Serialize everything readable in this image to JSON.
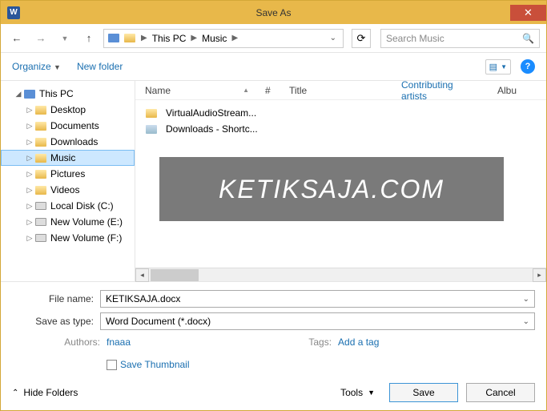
{
  "title": "Save As",
  "word_icon_letter": "W",
  "breadcrumb": {
    "item1": "This PC",
    "item2": "Music"
  },
  "search_placeholder": "Search Music",
  "toolbar": {
    "organize": "Organize",
    "newfolder": "New folder"
  },
  "tree": {
    "this_pc": "This PC",
    "desktop": "Desktop",
    "documents": "Documents",
    "downloads": "Downloads",
    "music": "Music",
    "pictures": "Pictures",
    "videos": "Videos",
    "local_c": "Local Disk (C:)",
    "vol_e": "New Volume (E:)",
    "vol_f": "New Volume (F:)"
  },
  "columns": {
    "name": "Name",
    "num": "#",
    "title": "Title",
    "contrib": "Contributing artists",
    "album": "Albu"
  },
  "files": {
    "f1": "VirtualAudioStream...",
    "f2": "Downloads - Shortc..."
  },
  "watermark": "KETIKSAJA.COM",
  "filename_label": "File name:",
  "filename_value": "KETIKSAJA.docx",
  "saveas_label": "Save as type:",
  "saveas_value": "Word Document (*.docx)",
  "authors_label": "Authors:",
  "authors_value": "fnaaa",
  "tags_label": "Tags:",
  "tags_value": "Add a tag",
  "save_thumbnail": "Save Thumbnail",
  "hide_folders": "Hide Folders",
  "tools": "Tools",
  "save": "Save",
  "cancel": "Cancel"
}
